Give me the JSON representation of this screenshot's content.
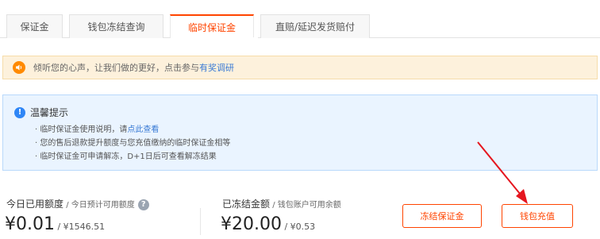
{
  "tabs": [
    {
      "label": "保证金"
    },
    {
      "label": "钱包冻结查询"
    },
    {
      "label": "临时保证金"
    },
    {
      "label": "直赔/延迟发货赔付"
    }
  ],
  "active_tab": "临时保证金",
  "banner": {
    "icon": "speaker-icon",
    "text": "倾听您的心声，让我们做的更好，点击参与",
    "link": "有奖调研"
  },
  "tips": {
    "icon": "info-icon",
    "title": "温馨提示",
    "line1_text": "· 临时保证金使用说明，请",
    "line1_link": "点此查看",
    "line2": "· 您的售后退款提升额度与您充值缴纳的临时保证金相等",
    "line3": "· 临时保证金可申请解冻，D+1日后可查看解冻结果"
  },
  "stats": {
    "left": {
      "label": "今日已用额度",
      "label_sub": " / 今日预计可用额度",
      "help_icon": "question-icon",
      "help_glyph": "?",
      "value": "¥0.01",
      "value_sub": " / ¥1546.51"
    },
    "right": {
      "label": "已冻结金额",
      "label_sub": " / 钱包账户可用余额",
      "value": "¥20.00",
      "value_sub": " / ¥0.53"
    }
  },
  "buttons": {
    "freeze": "冻结保证金",
    "recharge": "钱包充值"
  },
  "colors": {
    "accent": "#ff4400",
    "link": "#3a7bd5",
    "info": "#2f86f6",
    "annotation_arrow": "#e5161f"
  }
}
